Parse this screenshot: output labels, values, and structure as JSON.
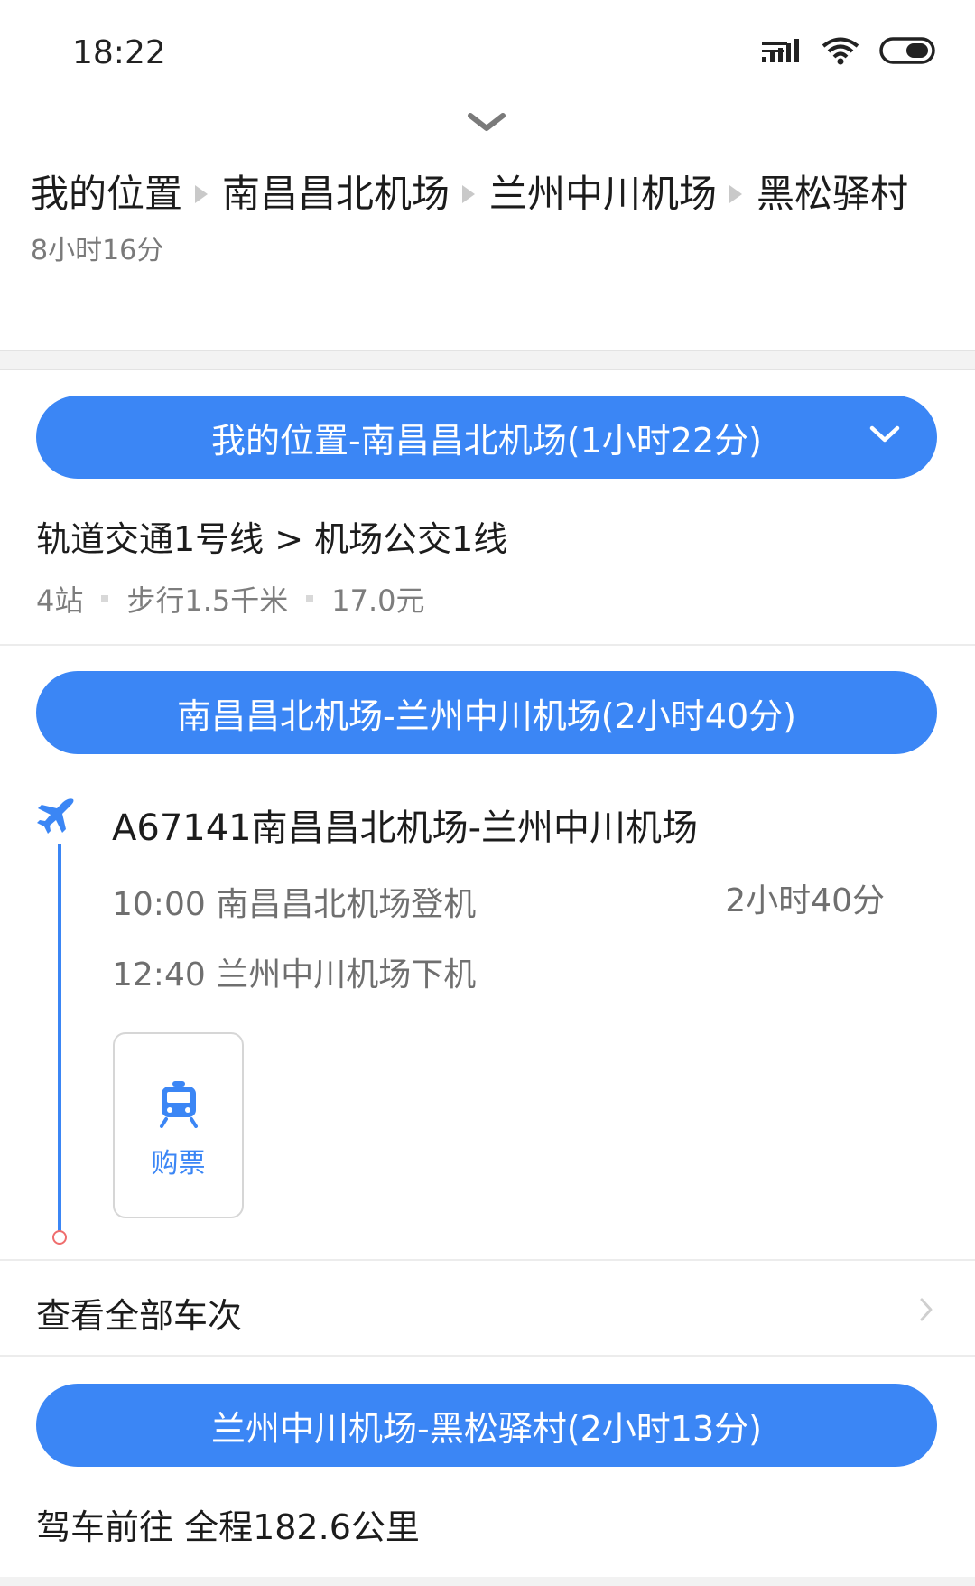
{
  "status_bar": {
    "time": "18:22"
  },
  "route": {
    "stops": [
      "我的位置",
      "南昌昌北机场",
      "兰州中川机场",
      "黑松驿村"
    ],
    "total_duration": "8小时16分"
  },
  "segments": {
    "s1": {
      "title": "我的位置-南昌昌北机场(1小时22分)",
      "lines": "轨道交通1号线 > 机场公交1线",
      "stations": "4站",
      "walk": "步行1.5千米",
      "price": "17.0元"
    },
    "s2": {
      "title": "南昌昌北机场-兰州中川机场(2小时40分)",
      "flight_title": "A67141南昌昌北机场-兰州中川机场",
      "depart": "10:00 南昌昌北机场登机",
      "arrive": "12:40 兰州中川机场下机",
      "duration": "2小时40分",
      "buy_label": "购票",
      "view_all": "查看全部车次"
    },
    "s3": {
      "title": "兰州中川机场-黑松驿村(2小时13分)",
      "drive": "驾车前往 全程182.6公里"
    }
  },
  "colors": {
    "accent": "#3b86f5",
    "text": "#1c1c1c",
    "muted": "#7a7a7a",
    "timeline_end": "#ef6d6d"
  },
  "icons": [
    "signal-icon",
    "wifi-icon",
    "battery-icon",
    "chevron-down-icon",
    "plane-icon",
    "ticket-icon",
    "chevron-right-icon"
  ]
}
